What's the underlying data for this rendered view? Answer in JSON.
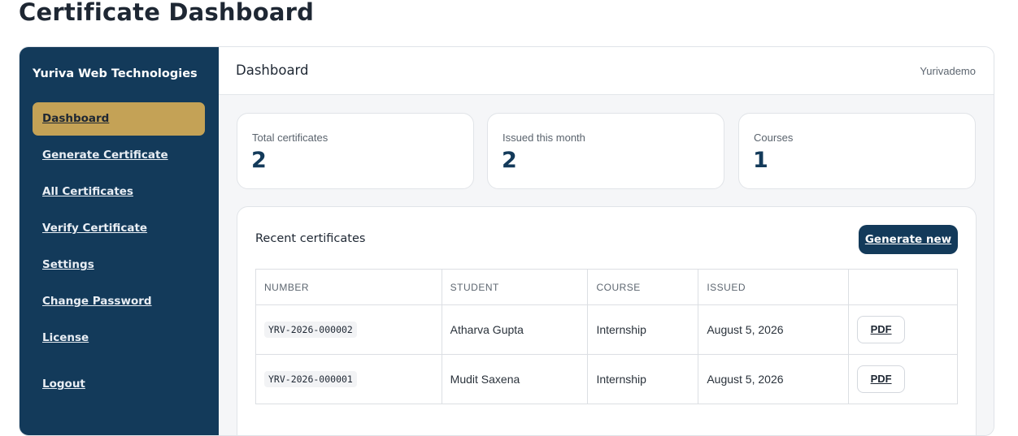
{
  "page": {
    "title": "Certificate Dashboard"
  },
  "sidebar": {
    "brand": "Yuriva Web Technologies",
    "items": [
      {
        "label": "Dashboard",
        "active": true
      },
      {
        "label": "Generate Certificate"
      },
      {
        "label": "All Certificates"
      },
      {
        "label": "Verify Certificate"
      },
      {
        "label": "Settings"
      },
      {
        "label": "Change Password"
      },
      {
        "label": "License"
      },
      {
        "label": "Logout"
      }
    ]
  },
  "topbar": {
    "title": "Dashboard",
    "user": "Yurivademo"
  },
  "stats": [
    {
      "label": "Total certificates",
      "value": "2"
    },
    {
      "label": "Issued this month",
      "value": "2"
    },
    {
      "label": "Courses",
      "value": "1"
    }
  ],
  "recent": {
    "title": "Recent certificates",
    "generate_label": "Generate new",
    "columns": [
      "NUMBER",
      "STUDENT",
      "COURSE",
      "ISSUED",
      ""
    ],
    "rows": [
      {
        "number": "YRV-2026-000002",
        "student": "Atharva Gupta",
        "course": "Internship",
        "issued": "August 5, 2026",
        "action": "PDF"
      },
      {
        "number": "YRV-2026-000001",
        "student": "Mudit Saxena",
        "course": "Internship",
        "issued": "August 5, 2026",
        "action": "PDF"
      }
    ]
  },
  "colors": {
    "sidebar_bg": "#133a5a",
    "active_item": "#c4a256",
    "accent": "#133a5a"
  }
}
